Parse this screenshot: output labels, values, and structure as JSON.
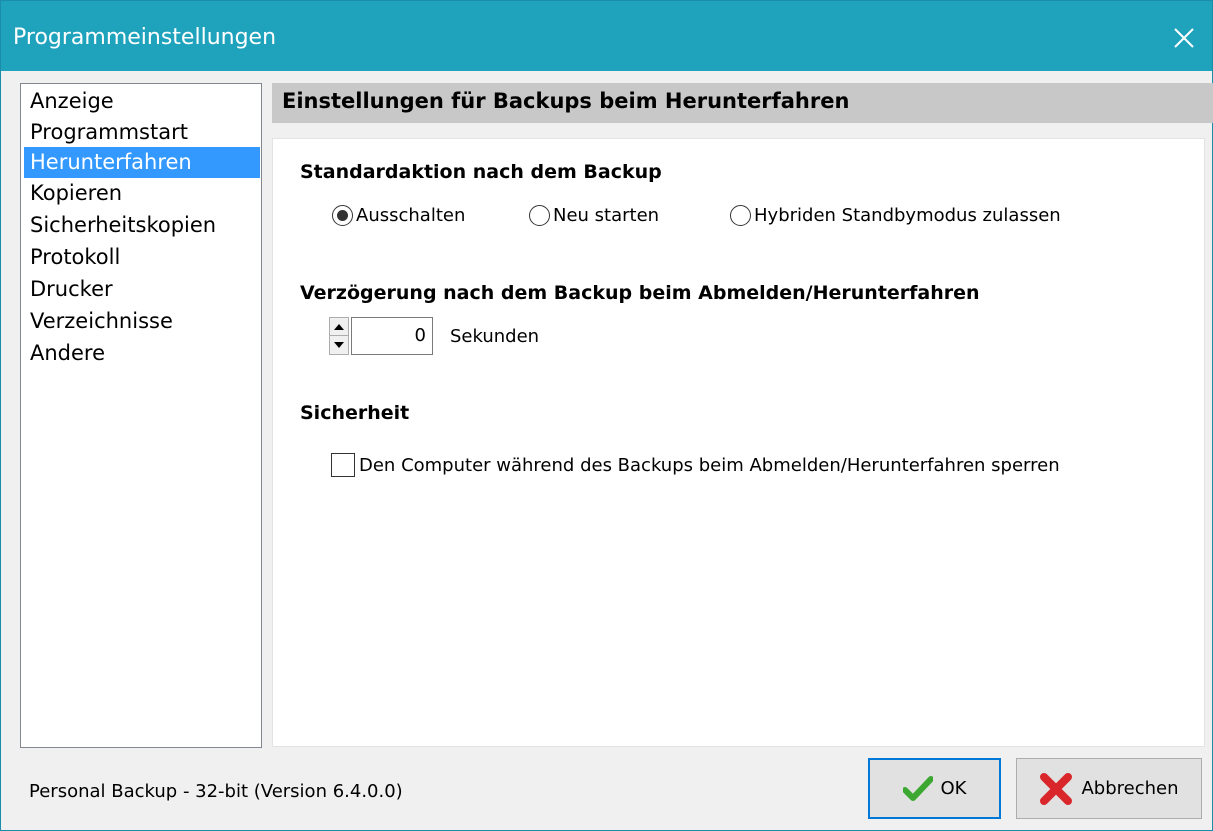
{
  "window": {
    "title": "Programmeinstellungen",
    "close_icon": "close-icon",
    "titlebar_color": "#1fa3bd"
  },
  "sidebar": {
    "items": [
      {
        "label": "Anzeige",
        "selected": false
      },
      {
        "label": "Programmstart",
        "selected": false
      },
      {
        "label": "Herunterfahren",
        "selected": true
      },
      {
        "label": "Kopieren",
        "selected": false
      },
      {
        "label": "Sicherheitskopien",
        "selected": false
      },
      {
        "label": "Protokoll",
        "selected": false
      },
      {
        "label": "Drucker",
        "selected": false
      },
      {
        "label": "Verzeichnisse",
        "selected": false
      },
      {
        "label": "Andere",
        "selected": false
      }
    ],
    "selection_color": "#3399ff"
  },
  "panel": {
    "title": "Einstellungen für Backups beim Herunterfahren",
    "default_action": {
      "heading": "Standardaktion nach dem Backup",
      "options": [
        {
          "label": "Ausschalten",
          "checked": true
        },
        {
          "label": "Neu starten",
          "checked": false
        },
        {
          "label": "Hybriden Standbymodus zulassen",
          "checked": false
        }
      ]
    },
    "delay": {
      "heading": "Verzögerung nach dem Backup beim Abmelden/Herunterfahren",
      "value": "0",
      "unit": "Sekunden"
    },
    "security": {
      "heading": "Sicherheit",
      "lock_label": "Den Computer während des Backups beim Abmelden/Herunterfahren sperren",
      "lock_checked": false
    }
  },
  "footer": {
    "status": "Personal Backup - 32-bit (Version 6.4.0.0)",
    "ok_label": "OK",
    "ok_icon": "checkmark-icon",
    "cancel_label": "Abbrechen",
    "cancel_icon": "red-x-icon"
  }
}
